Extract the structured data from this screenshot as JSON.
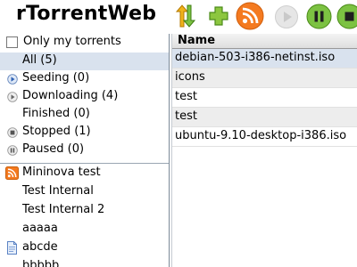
{
  "header": {
    "title": "rTorrentWeb",
    "buttons": [
      {
        "name": "refresh-sort-icon"
      },
      {
        "name": "add-icon"
      },
      {
        "name": "rss-icon"
      },
      {
        "name": "play-icon"
      },
      {
        "name": "pause-icon"
      },
      {
        "name": "stop-icon"
      }
    ]
  },
  "sidebar": {
    "only_my_torrents": "Only my torrents",
    "filters": [
      {
        "label": "All (5)",
        "icon": "none",
        "selected": true
      },
      {
        "label": "Seeding (0)",
        "icon": "seeding-icon"
      },
      {
        "label": "Downloading (4)",
        "icon": "downloading-icon"
      },
      {
        "label": "Finished (0)",
        "icon": "none"
      },
      {
        "label": "Stopped (1)",
        "icon": "stopped-icon"
      },
      {
        "label": "Paused (0)",
        "icon": "paused-icon"
      }
    ],
    "feeds": [
      {
        "label": "Mininova test",
        "icon": "rss-feed-icon"
      },
      {
        "label": "Test Internal",
        "icon": "none"
      },
      {
        "label": "Test Internal 2",
        "icon": "none"
      },
      {
        "label": "aaaaa",
        "icon": "none"
      },
      {
        "label": "abcde",
        "icon": "document-icon"
      },
      {
        "label": "bbbbb",
        "icon": "none"
      }
    ]
  },
  "torrents": {
    "column_name": "Name",
    "rows": [
      {
        "name": "debian-503-i386-netinst.iso"
      },
      {
        "name": "icons"
      },
      {
        "name": "test"
      },
      {
        "name": "test"
      },
      {
        "name": "ubuntu-9.10-desktop-i386.iso"
      }
    ]
  }
}
